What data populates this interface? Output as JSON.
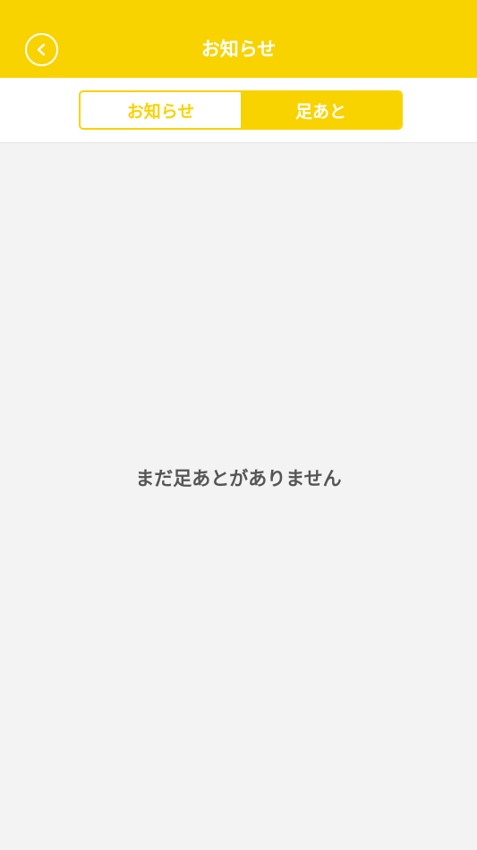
{
  "header": {
    "title": "お知らせ",
    "back_icon": "chevron-left-icon",
    "background_color": "#f8d300"
  },
  "tabs": [
    {
      "label": "お知らせ",
      "selected": false
    },
    {
      "label": "足あと",
      "selected": true
    }
  ],
  "accent_color": "#f8d300",
  "empty_state": {
    "message": "まだ足あとがありません"
  }
}
